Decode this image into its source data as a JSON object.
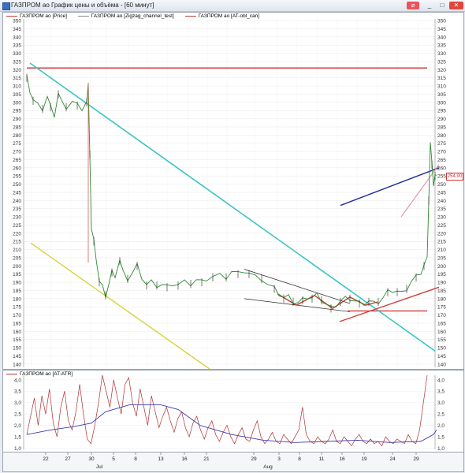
{
  "window": {
    "title": "ГАЗПРОМ ао График цены и объёма - [60 минут]",
    "buttons": [
      "_",
      "□",
      "✕"
    ]
  },
  "main_panel": {
    "legend": [
      {
        "label": "ГАЗПРОМ ао [Price]",
        "color": "#c0392b"
      },
      {
        "label": "ГАЗПРОМ ао [Zigzag_channel_test]",
        "color": "#888888"
      },
      {
        "label": "ГАЗПРОМ ао [AT-obl_can]",
        "color": "#c0392b"
      }
    ],
    "y_ticks": [
      140,
      145,
      150,
      155,
      160,
      165,
      170,
      175,
      180,
      185,
      190,
      195,
      200,
      205,
      210,
      215,
      220,
      225,
      230,
      235,
      240,
      245,
      250,
      255,
      260,
      265,
      270,
      275,
      280,
      285,
      290,
      295,
      300,
      305,
      310,
      315,
      320,
      325,
      330,
      335,
      340,
      345,
      350
    ],
    "current_price": "254,90"
  },
  "atr_panel": {
    "legend": [
      {
        "label": "ГАЗПРОМ ао [AT-ATR]",
        "color": "#c0392b"
      }
    ],
    "y_ticks": [
      "1,0",
      "1,5",
      "2,0",
      "2,5",
      "3,0",
      "3,5",
      "4,0"
    ]
  },
  "x_axis": {
    "day_ticks": [
      "22",
      "27",
      "30",
      "5",
      "8",
      "13",
      "16",
      "21",
      "29",
      "3",
      "8",
      "11",
      "16",
      "19",
      "24",
      "29"
    ],
    "month_labels": [
      "Jul",
      "Aug"
    ]
  },
  "chart_data": {
    "type": "line",
    "title": "",
    "ylim": [
      138,
      351
    ],
    "levels": [
      {
        "name": "",
        "value": 321,
        "color": "#d63b3b"
      },
      {
        "name": "",
        "value": 172.5,
        "color": "#d63b3b"
      }
    ],
    "price_approx": [
      {
        "x": "Jun-19",
        "y": 315
      },
      {
        "x": "Jun-22",
        "y": 300
      },
      {
        "x": "Jun-25",
        "y": 297
      },
      {
        "x": "Jun-28",
        "y": 300
      },
      {
        "x": "Jun-30",
        "y": 310
      },
      {
        "x": "Jul-01",
        "y": 212
      },
      {
        "x": "Jul-03",
        "y": 188
      },
      {
        "x": "Jul-08",
        "y": 195
      },
      {
        "x": "Jul-13",
        "y": 189
      },
      {
        "x": "Jul-21",
        "y": 190
      },
      {
        "x": "Jul-29",
        "y": 196
      },
      {
        "x": "Aug-03",
        "y": 187
      },
      {
        "x": "Aug-08",
        "y": 177
      },
      {
        "x": "Aug-11",
        "y": 180
      },
      {
        "x": "Aug-16",
        "y": 177
      },
      {
        "x": "Aug-19",
        "y": 178
      },
      {
        "x": "Aug-24",
        "y": 184
      },
      {
        "x": "Aug-29",
        "y": 192
      },
      {
        "x": "Aug-31",
        "y": 203
      },
      {
        "x": "Sep-01",
        "y": 255
      }
    ]
  }
}
